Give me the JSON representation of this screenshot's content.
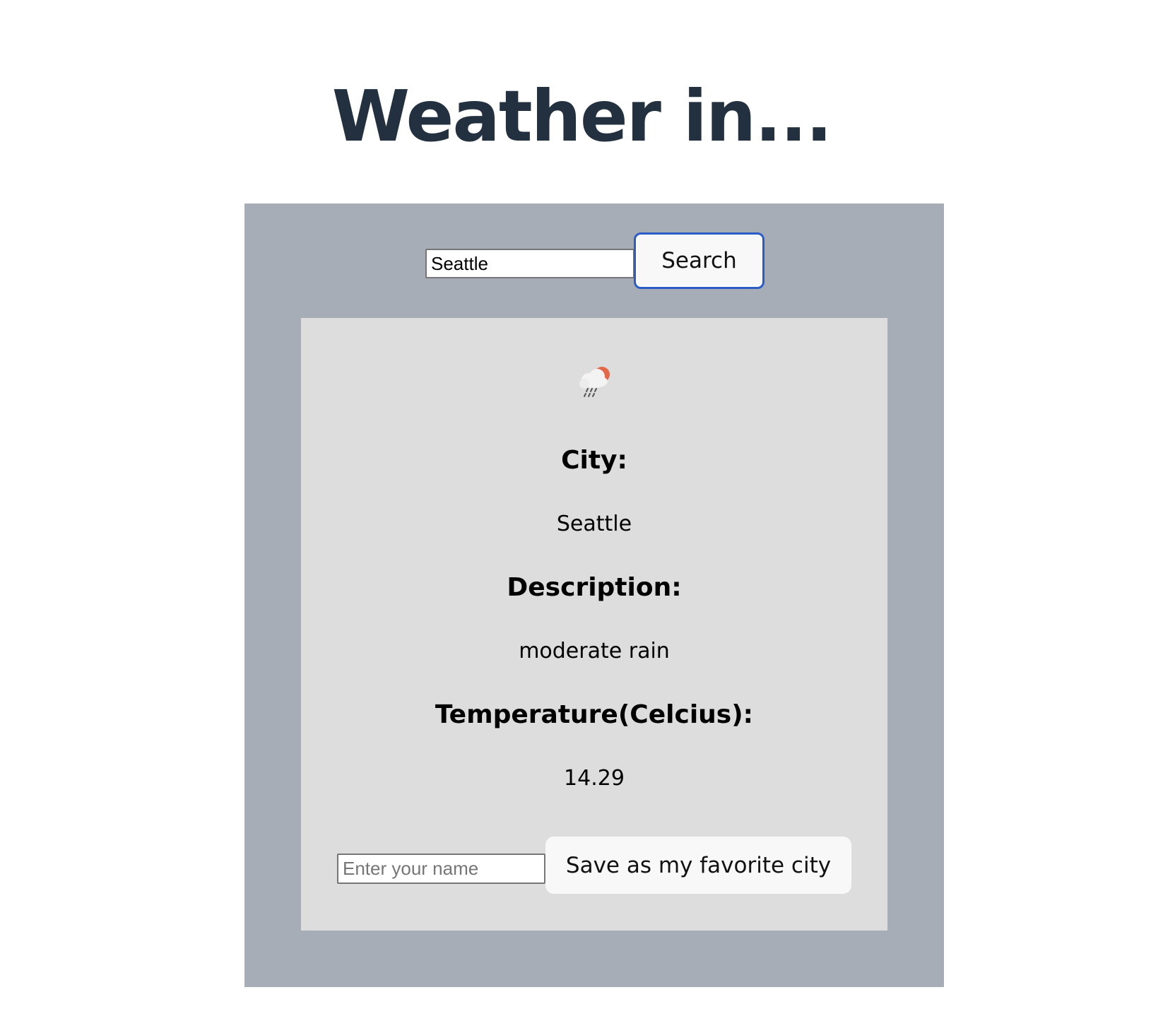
{
  "page": {
    "title": "Weather in..."
  },
  "search": {
    "value": "Seattle",
    "button_label": "Search"
  },
  "result": {
    "icon": "rain-cloud-sun-icon",
    "city_label": "City:",
    "city_value": "Seattle",
    "description_label": "Description:",
    "description_value": "moderate rain",
    "temperature_label": "Temperature(Celcius):",
    "temperature_value": "14.29"
  },
  "favorite": {
    "name_placeholder": "Enter your name",
    "save_label": "Save as my favorite city"
  },
  "colors": {
    "title": "#233040",
    "outer_panel": "#a7adb6",
    "result_card": "#dcdddc",
    "focus_border": "#2c5cc5",
    "sun": "#e2694a"
  }
}
